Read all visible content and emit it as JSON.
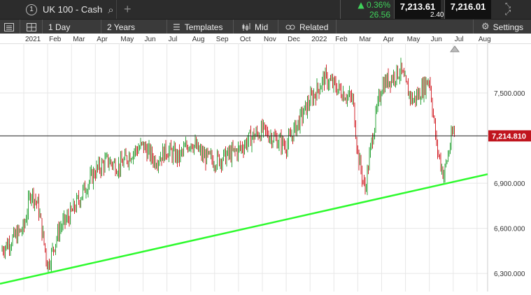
{
  "instrument": {
    "tab_number": "1",
    "name": "UK 100 - Cash"
  },
  "quote": {
    "change_pct": "0.36%",
    "change_pts": "26.56",
    "bid": "7,213.61",
    "spread": "2.40",
    "ask": "7,216.01"
  },
  "toolbar": {
    "interval": "1 Day",
    "range": "2 Years",
    "templates": "Templates",
    "price_type": "Mid",
    "related": "Related",
    "settings": "Settings"
  },
  "time_axis": [
    {
      "label": "2021",
      "x": 0.0
    },
    {
      "label": "Feb",
      "x": 1.0
    },
    {
      "label": "Mar",
      "x": 2.0
    },
    {
      "label": "Apr",
      "x": 3.0
    },
    {
      "label": "May",
      "x": 4.0
    },
    {
      "label": "Jun",
      "x": 5.0
    },
    {
      "label": "Jul",
      "x": 6.0
    },
    {
      "label": "Aug",
      "x": 7.0
    },
    {
      "label": "Sep",
      "x": 8.0
    },
    {
      "label": "Oct",
      "x": 9.0
    },
    {
      "label": "Nov",
      "x": 10.0
    },
    {
      "label": "Dec",
      "x": 11.0
    },
    {
      "label": "2022",
      "x": 12.0
    },
    {
      "label": "Feb",
      "x": 13.0
    },
    {
      "label": "Mar",
      "x": 14.0
    },
    {
      "label": "Apr",
      "x": 15.0
    },
    {
      "label": "May",
      "x": 16.0
    },
    {
      "label": "Jun",
      "x": 17.0
    },
    {
      "label": "Jul",
      "x": 18.0
    },
    {
      "label": "Aug",
      "x": 19.0
    }
  ],
  "price_axis": [
    "7,500.000",
    "6,900.000",
    "6,600.000",
    "6,300.000"
  ],
  "chart_data": {
    "type": "line",
    "current_price": 7214.81,
    "current_price_label": "7,214.810",
    "ylim": [
      6180,
      7830
    ],
    "xlim": [
      -1,
      19.2
    ],
    "series": [
      {
        "values_x": [
          -1,
          0,
          0.3,
          0.6,
          1,
          1.5,
          2,
          2.5,
          3,
          3.5,
          4,
          4.5,
          5,
          5.5,
          6,
          6.5,
          7,
          7.5,
          8,
          8.5,
          9,
          9.5,
          10,
          10.5,
          11,
          11.5,
          12,
          12.3,
          12.6,
          13,
          13.4,
          13.8,
          14,
          14.3,
          14.6,
          15,
          15.4,
          15.8,
          16,
          16.3,
          16.6,
          17,
          17.3,
          17.6,
          18,
          18.4
        ],
        "values_y": [
          6450,
          6600,
          6850,
          6750,
          6350,
          6600,
          6700,
          6850,
          6980,
          7050,
          7010,
          7100,
          7150,
          7050,
          7120,
          7070,
          7180,
          7080,
          7050,
          7080,
          7120,
          7200,
          7250,
          7200,
          7150,
          7300,
          7450,
          7520,
          7600,
          7550,
          7500,
          7450,
          7100,
          6850,
          7200,
          7550,
          7600,
          7650,
          7550,
          7450,
          7500,
          7600,
          7150,
          6950,
          7250,
          7100
        ]
      },
      {
        "values_x": [
          -1,
          19.0
        ],
        "values_y": [
          6250,
          6960
        ]
      }
    ],
    "colors": {
      "up": "#2ea43b",
      "down": "#d3242b",
      "trend": "#2dfa2d",
      "price_line": "#222222",
      "price_badge": "#c0151e",
      "grid": "#e7e7e7"
    }
  }
}
